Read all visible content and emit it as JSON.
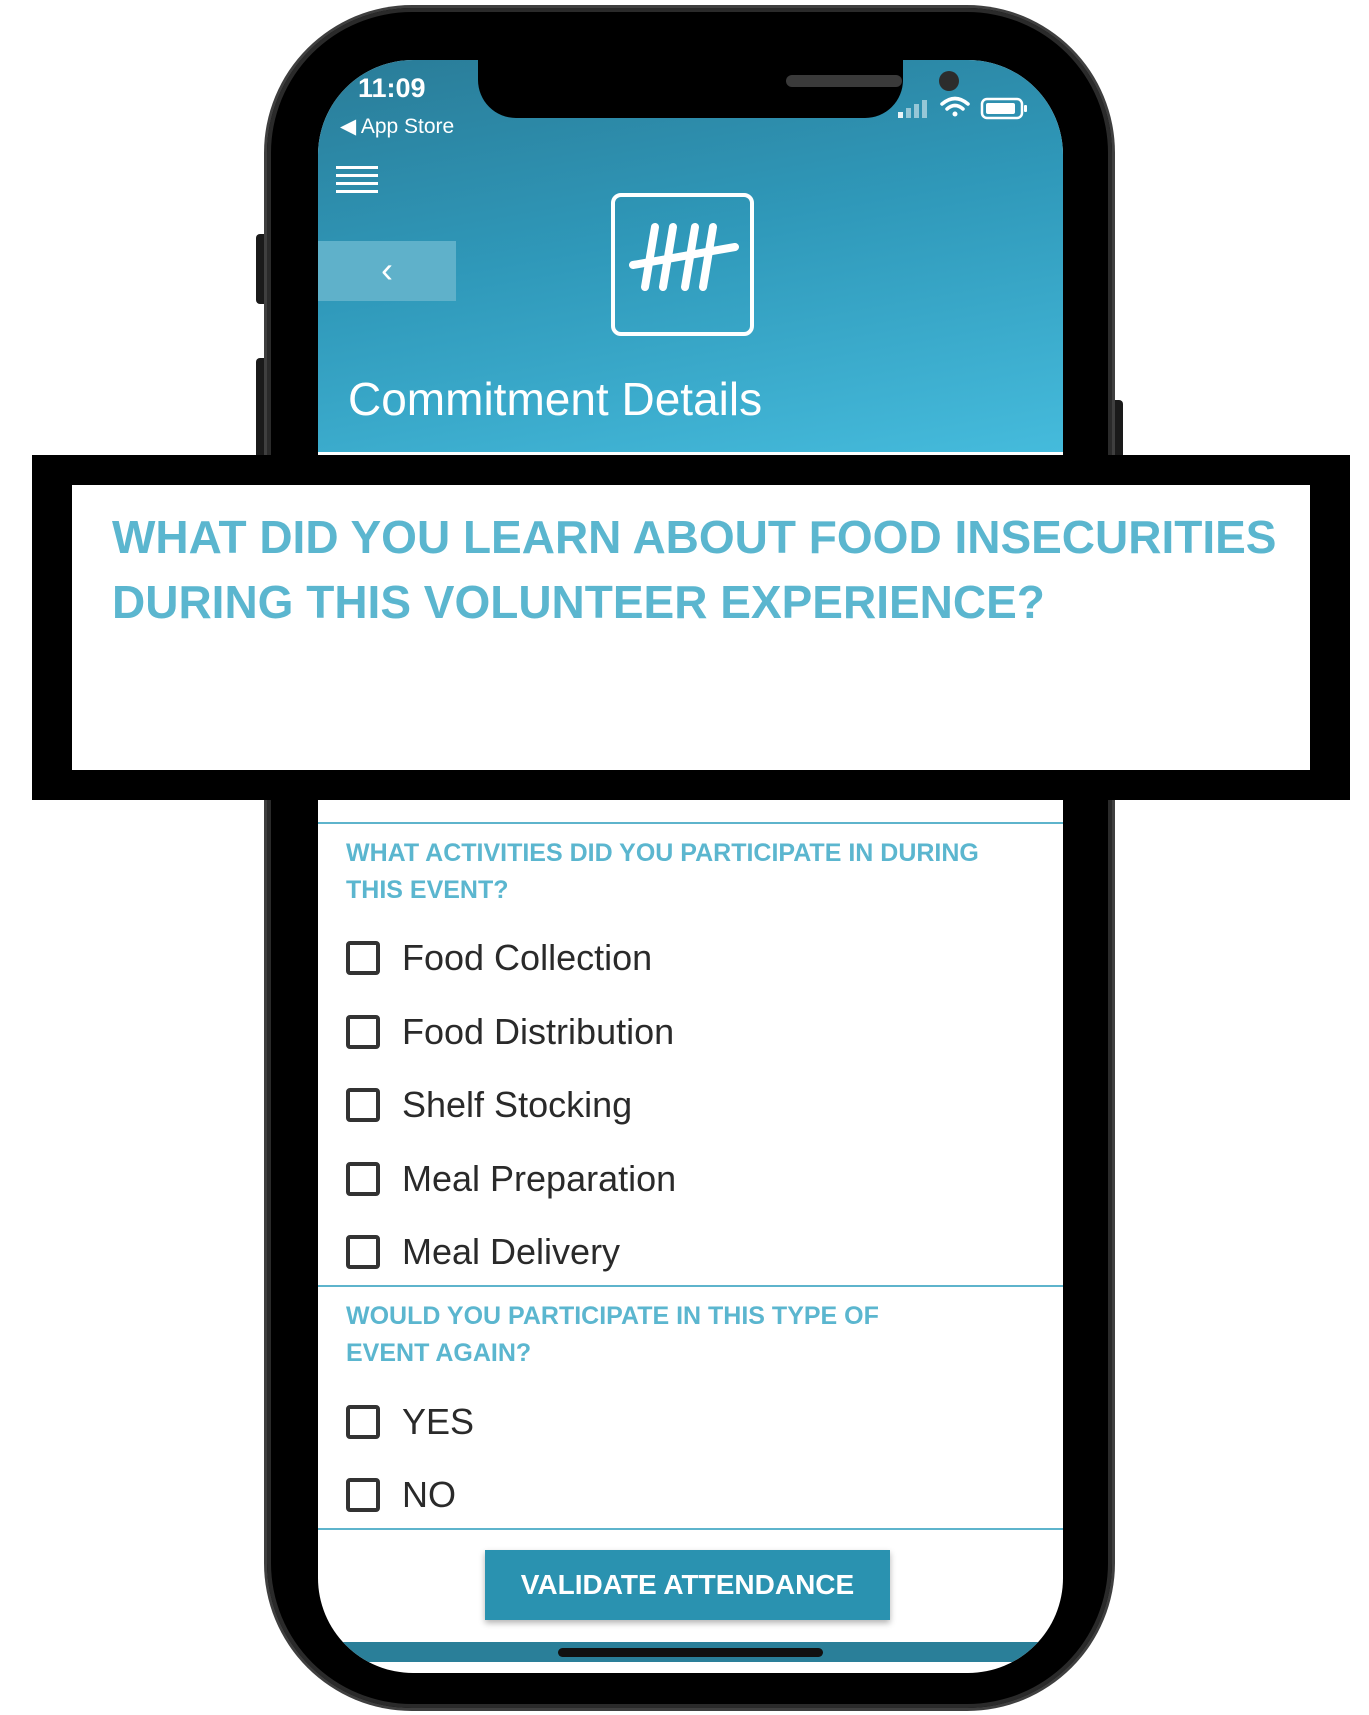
{
  "status_bar": {
    "time": "11:09",
    "back_app": "◀ App Store"
  },
  "header": {
    "title": "Commitment Details",
    "back_glyph": "‹"
  },
  "callout": {
    "question": "WHAT DID YOU LEARN ABOUT FOOD INSECURITIES DURING THIS VOLUNTEER EXPERIENCE?"
  },
  "activities": {
    "question": "WHAT ACTIVITIES DID YOU PARTICIPATE IN DURING THIS EVENT?",
    "options": [
      "Food Collection",
      "Food Distribution",
      "Shelf Stocking",
      "Meal Preparation",
      "Meal Delivery"
    ]
  },
  "participate_again": {
    "question": "WOULD YOU PARTICIPATE IN THIS TYPE OF EVENT AGAIN?",
    "options": [
      "YES",
      "NO"
    ]
  },
  "validate_button": "VALIDATE ATTENDANCE",
  "colors": {
    "accent": "#5bb6cf",
    "header_dark": "#2a7c98",
    "header_light": "#45bbdc",
    "button": "#2a92b0"
  }
}
